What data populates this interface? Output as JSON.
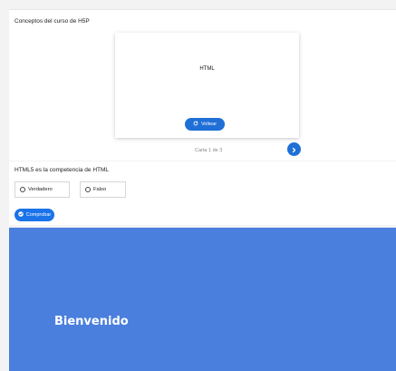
{
  "flashcards": {
    "title": "Conceptos del curso de H5P",
    "card_text": "HTML",
    "flip_label": "Voltear",
    "counter": "Carta 1 de 3"
  },
  "quiz": {
    "question": "HTML5 es la competencia de HTML",
    "options": [
      "Verdadero",
      "Falso"
    ],
    "check_label": "Comprobar"
  },
  "welcome": {
    "text": "Bienvenido"
  },
  "colors": {
    "accent": "#1f6fd6",
    "banner": "#4a7fde"
  }
}
